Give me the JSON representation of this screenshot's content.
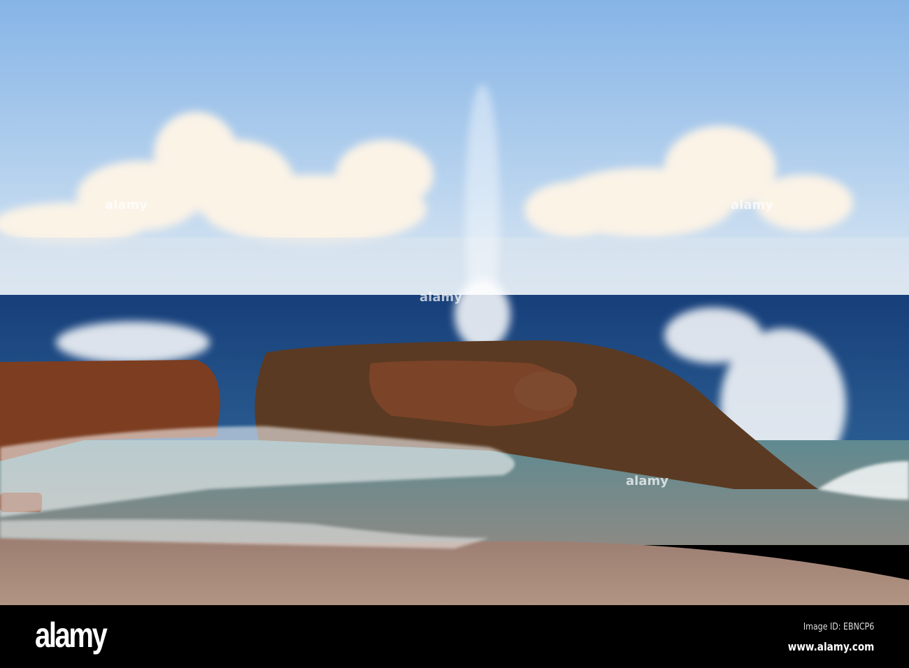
{
  "photo": {
    "subject": "waves-splashing-on-rocks",
    "colors": {
      "sky_top": "#8bb8e8",
      "sky_horizon": "#dce8f4",
      "sea": "#1d4f8c",
      "rock": "#7a3e22",
      "sand": "#a8887a"
    }
  },
  "watermark": {
    "logo_text": "alamy",
    "image_id": "Image ID: EBNCP6",
    "website": "www.alamy.com"
  }
}
